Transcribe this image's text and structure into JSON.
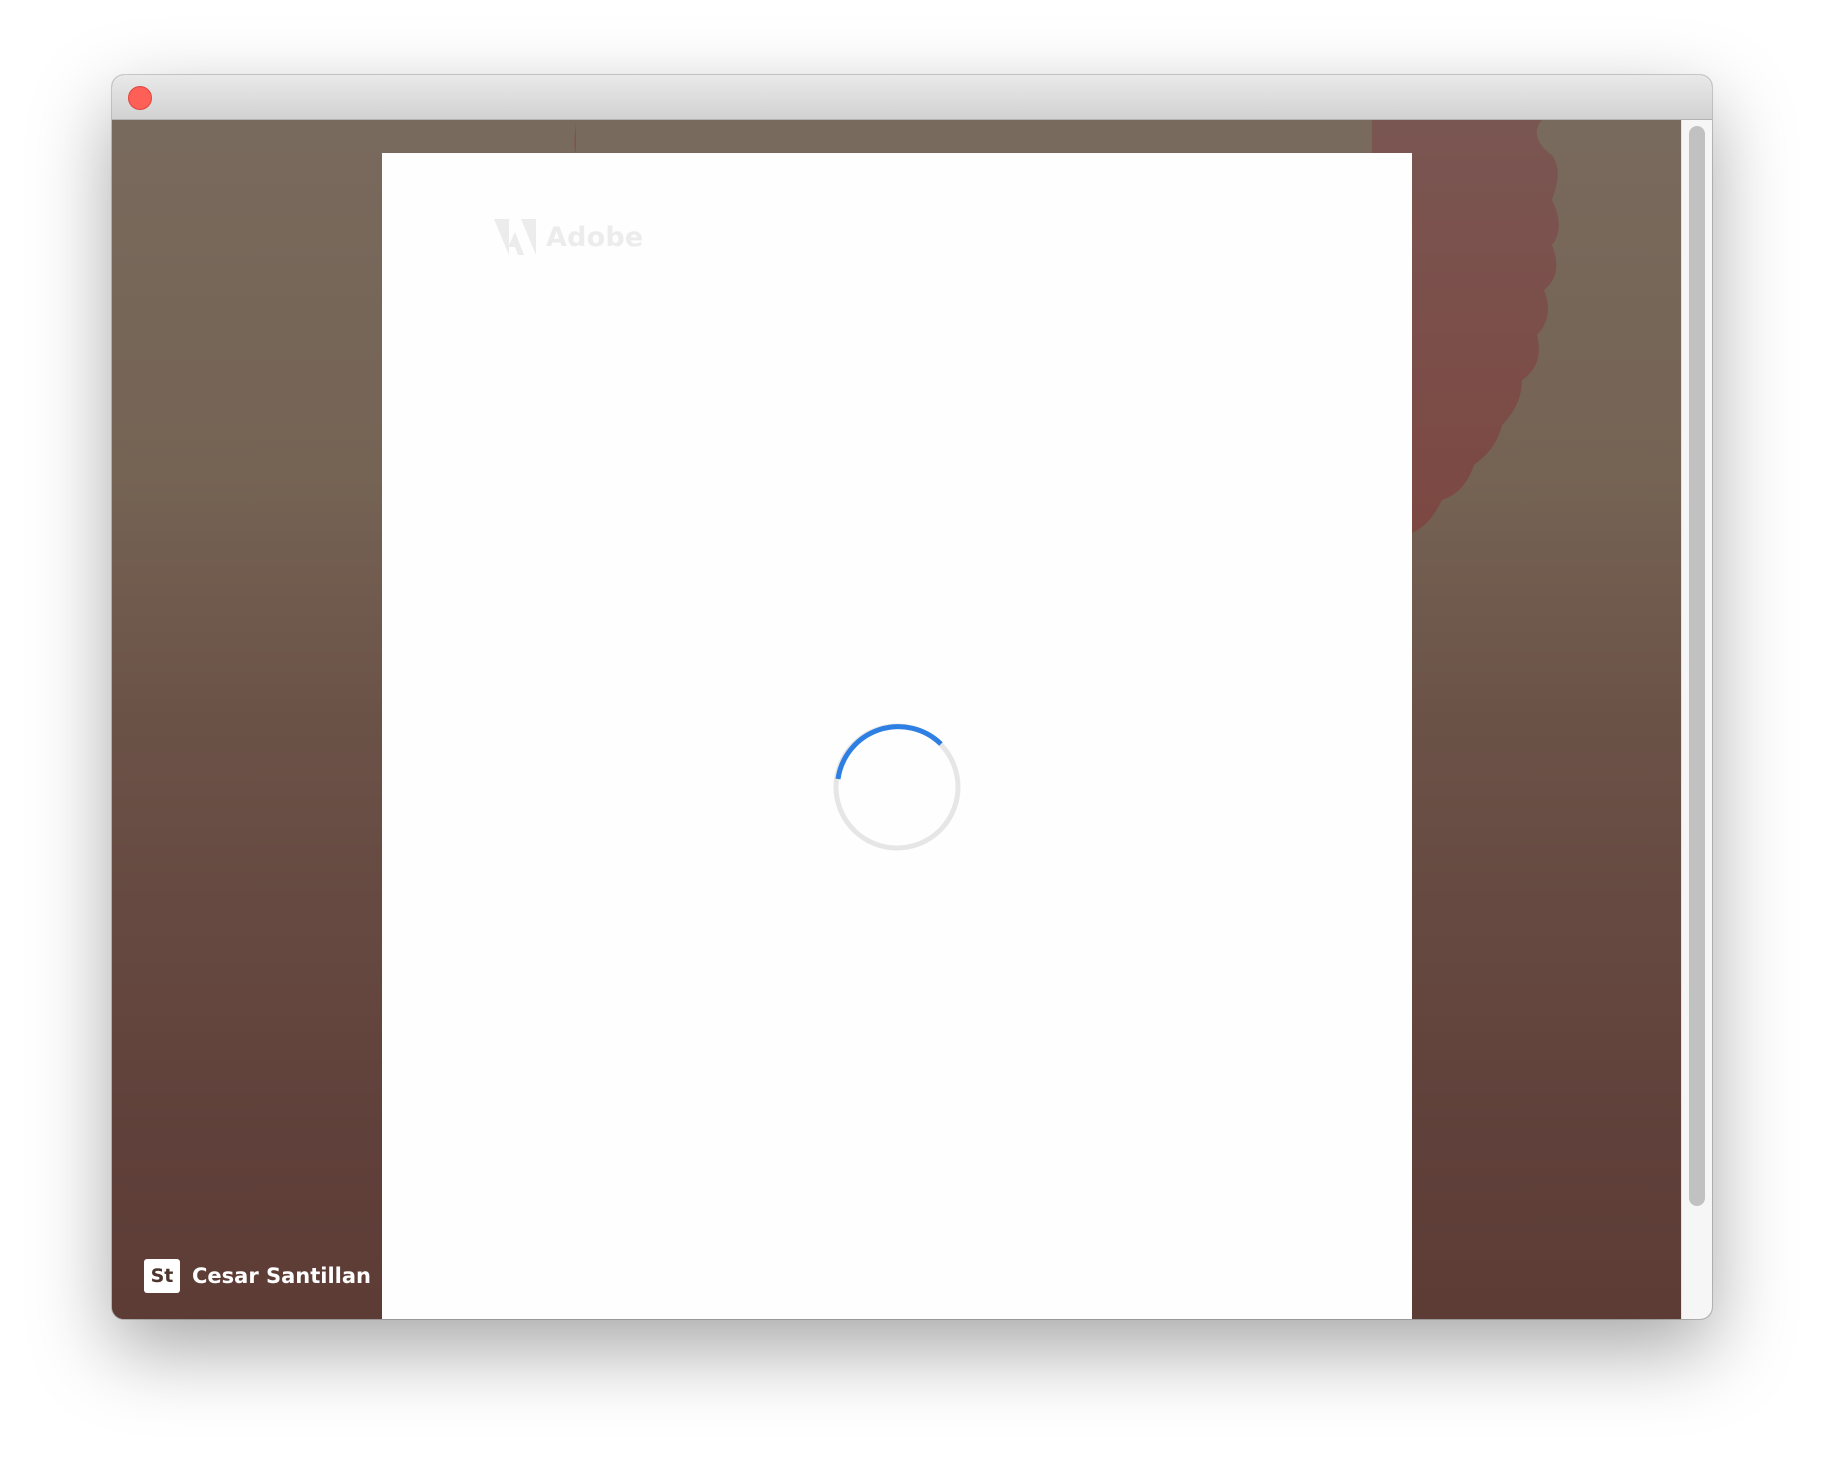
{
  "window": {
    "close_button": "close"
  },
  "sheet": {
    "logo_text": "Adobe",
    "loading": "loading-spinner"
  },
  "credit": {
    "badge": "St",
    "author": "Cesar Santillan"
  },
  "colors": {
    "spinner_accent": "#2d7fe3",
    "spinner_track": "#e6e6e6",
    "close_red": "#fe5f57"
  }
}
